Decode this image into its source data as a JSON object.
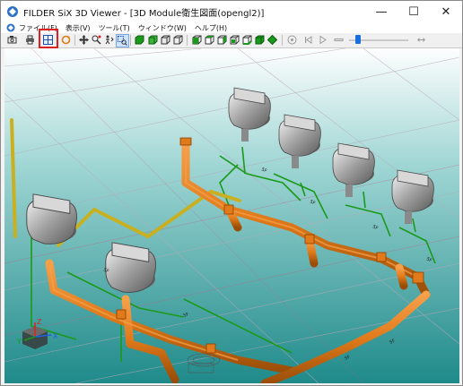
{
  "window": {
    "title": "FILDER SiX 3D Viewer - [3D Module衛生図面(opengl2)]",
    "minimize_glyph": "—",
    "maximize_glyph": "☐",
    "close_glyph": "✕"
  },
  "menu": {
    "items": [
      "ファイル(F)",
      "表示(V)",
      "ツール(T)",
      "ウィンドウ(W)",
      "ヘルプ(H)"
    ],
    "mdi_minimize": "_",
    "mdi_restore": "❐",
    "mdi_close": "×"
  },
  "toolbar": {
    "highlighted_button": "grid-view",
    "slider_position": 0.05
  },
  "viewport": {
    "background_top": "#ffffff",
    "background_bottom": "#1f8a8a",
    "axis_labels": {
      "x": "X",
      "y": "Y",
      "z": "Z"
    },
    "pipe_labels": [
      "5F",
      "5F",
      "5F",
      "5F",
      "5F",
      "5F",
      "5F",
      "5F"
    ]
  },
  "colors": {
    "pipe_orange": "#e07a1a",
    "pipe_green": "#1a9a1a",
    "pipe_yellow": "#c8b020",
    "highlight_red": "#e02020"
  }
}
